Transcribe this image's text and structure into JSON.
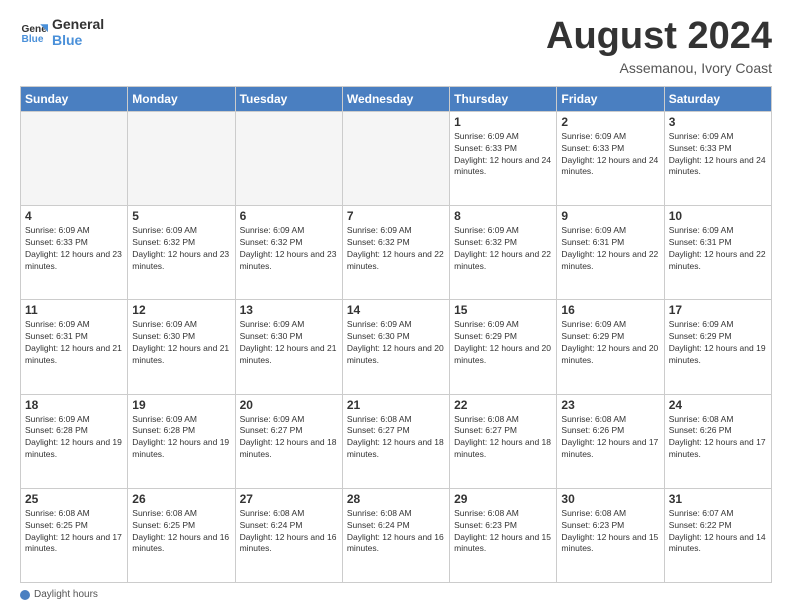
{
  "logo": {
    "line1": "General",
    "line2": "Blue"
  },
  "title": "August 2024",
  "subtitle": "Assemanou, Ivory Coast",
  "days_of_week": [
    "Sunday",
    "Monday",
    "Tuesday",
    "Wednesday",
    "Thursday",
    "Friday",
    "Saturday"
  ],
  "footer_label": "Daylight hours",
  "weeks": [
    [
      {
        "day": "",
        "info": ""
      },
      {
        "day": "",
        "info": ""
      },
      {
        "day": "",
        "info": ""
      },
      {
        "day": "",
        "info": ""
      },
      {
        "day": "1",
        "info": "Sunrise: 6:09 AM\nSunset: 6:33 PM\nDaylight: 12 hours and 24 minutes."
      },
      {
        "day": "2",
        "info": "Sunrise: 6:09 AM\nSunset: 6:33 PM\nDaylight: 12 hours and 24 minutes."
      },
      {
        "day": "3",
        "info": "Sunrise: 6:09 AM\nSunset: 6:33 PM\nDaylight: 12 hours and 24 minutes."
      }
    ],
    [
      {
        "day": "4",
        "info": "Sunrise: 6:09 AM\nSunset: 6:33 PM\nDaylight: 12 hours and 23 minutes."
      },
      {
        "day": "5",
        "info": "Sunrise: 6:09 AM\nSunset: 6:32 PM\nDaylight: 12 hours and 23 minutes."
      },
      {
        "day": "6",
        "info": "Sunrise: 6:09 AM\nSunset: 6:32 PM\nDaylight: 12 hours and 23 minutes."
      },
      {
        "day": "7",
        "info": "Sunrise: 6:09 AM\nSunset: 6:32 PM\nDaylight: 12 hours and 22 minutes."
      },
      {
        "day": "8",
        "info": "Sunrise: 6:09 AM\nSunset: 6:32 PM\nDaylight: 12 hours and 22 minutes."
      },
      {
        "day": "9",
        "info": "Sunrise: 6:09 AM\nSunset: 6:31 PM\nDaylight: 12 hours and 22 minutes."
      },
      {
        "day": "10",
        "info": "Sunrise: 6:09 AM\nSunset: 6:31 PM\nDaylight: 12 hours and 22 minutes."
      }
    ],
    [
      {
        "day": "11",
        "info": "Sunrise: 6:09 AM\nSunset: 6:31 PM\nDaylight: 12 hours and 21 minutes."
      },
      {
        "day": "12",
        "info": "Sunrise: 6:09 AM\nSunset: 6:30 PM\nDaylight: 12 hours and 21 minutes."
      },
      {
        "day": "13",
        "info": "Sunrise: 6:09 AM\nSunset: 6:30 PM\nDaylight: 12 hours and 21 minutes."
      },
      {
        "day": "14",
        "info": "Sunrise: 6:09 AM\nSunset: 6:30 PM\nDaylight: 12 hours and 20 minutes."
      },
      {
        "day": "15",
        "info": "Sunrise: 6:09 AM\nSunset: 6:29 PM\nDaylight: 12 hours and 20 minutes."
      },
      {
        "day": "16",
        "info": "Sunrise: 6:09 AM\nSunset: 6:29 PM\nDaylight: 12 hours and 20 minutes."
      },
      {
        "day": "17",
        "info": "Sunrise: 6:09 AM\nSunset: 6:29 PM\nDaylight: 12 hours and 19 minutes."
      }
    ],
    [
      {
        "day": "18",
        "info": "Sunrise: 6:09 AM\nSunset: 6:28 PM\nDaylight: 12 hours and 19 minutes."
      },
      {
        "day": "19",
        "info": "Sunrise: 6:09 AM\nSunset: 6:28 PM\nDaylight: 12 hours and 19 minutes."
      },
      {
        "day": "20",
        "info": "Sunrise: 6:09 AM\nSunset: 6:27 PM\nDaylight: 12 hours and 18 minutes."
      },
      {
        "day": "21",
        "info": "Sunrise: 6:08 AM\nSunset: 6:27 PM\nDaylight: 12 hours and 18 minutes."
      },
      {
        "day": "22",
        "info": "Sunrise: 6:08 AM\nSunset: 6:27 PM\nDaylight: 12 hours and 18 minutes."
      },
      {
        "day": "23",
        "info": "Sunrise: 6:08 AM\nSunset: 6:26 PM\nDaylight: 12 hours and 17 minutes."
      },
      {
        "day": "24",
        "info": "Sunrise: 6:08 AM\nSunset: 6:26 PM\nDaylight: 12 hours and 17 minutes."
      }
    ],
    [
      {
        "day": "25",
        "info": "Sunrise: 6:08 AM\nSunset: 6:25 PM\nDaylight: 12 hours and 17 minutes."
      },
      {
        "day": "26",
        "info": "Sunrise: 6:08 AM\nSunset: 6:25 PM\nDaylight: 12 hours and 16 minutes."
      },
      {
        "day": "27",
        "info": "Sunrise: 6:08 AM\nSunset: 6:24 PM\nDaylight: 12 hours and 16 minutes."
      },
      {
        "day": "28",
        "info": "Sunrise: 6:08 AM\nSunset: 6:24 PM\nDaylight: 12 hours and 16 minutes."
      },
      {
        "day": "29",
        "info": "Sunrise: 6:08 AM\nSunset: 6:23 PM\nDaylight: 12 hours and 15 minutes."
      },
      {
        "day": "30",
        "info": "Sunrise: 6:08 AM\nSunset: 6:23 PM\nDaylight: 12 hours and 15 minutes."
      },
      {
        "day": "31",
        "info": "Sunrise: 6:07 AM\nSunset: 6:22 PM\nDaylight: 12 hours and 14 minutes."
      }
    ]
  ]
}
